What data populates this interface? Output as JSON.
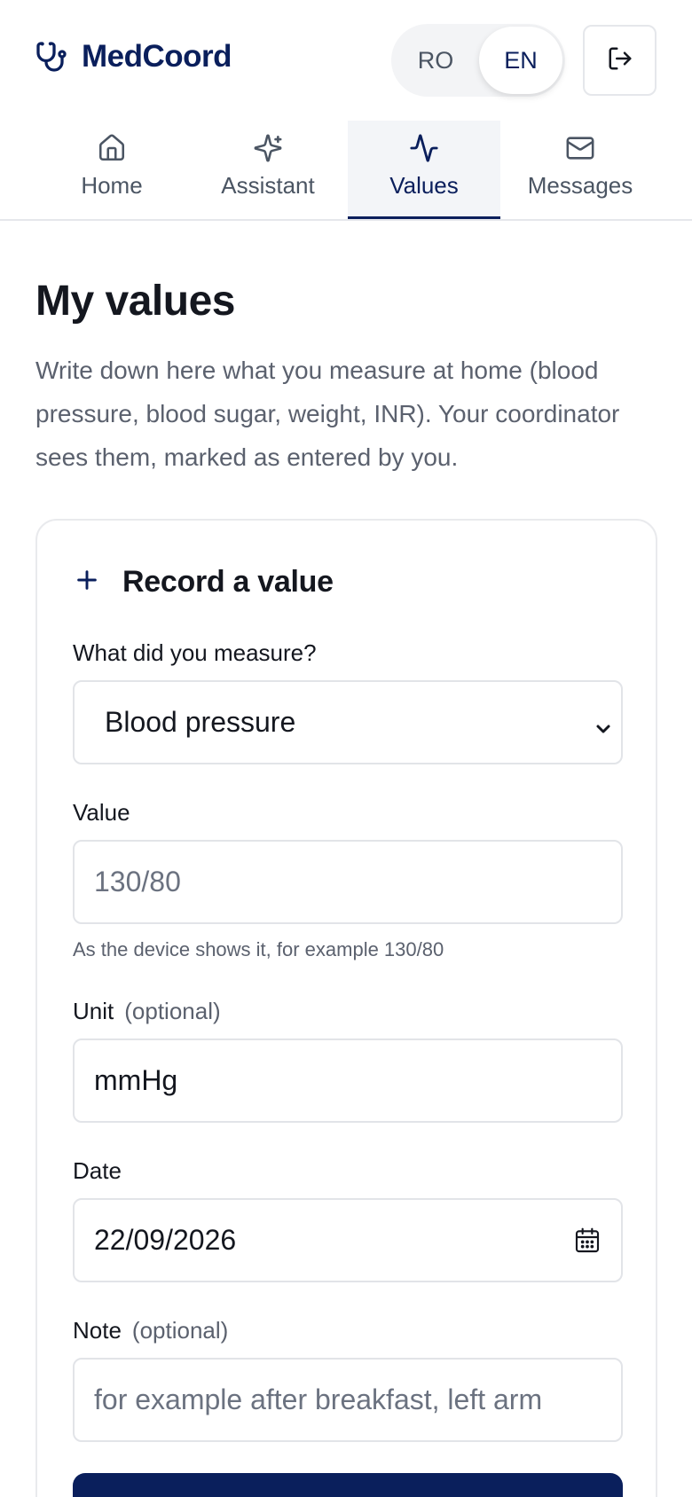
{
  "app": {
    "name": "MedCoord",
    "logo_icon": "stethoscope-icon"
  },
  "language": {
    "options": [
      "RO",
      "EN"
    ],
    "selected": "EN"
  },
  "header": {
    "logout_icon": "logout-icon"
  },
  "tabs": [
    {
      "label": "Home",
      "icon": "home-icon",
      "active": false
    },
    {
      "label": "Assistant",
      "icon": "sparkles-icon",
      "active": false
    },
    {
      "label": "Values",
      "icon": "activity-icon",
      "active": true
    },
    {
      "label": "Messages",
      "icon": "mail-icon",
      "active": false
    }
  ],
  "main": {
    "title": "My values",
    "description": "Write down here what you measure at home (blood pressure, blood sugar, weight, INR). Your coordinator sees them, marked as entered by you."
  },
  "form": {
    "title": "Record a value",
    "title_icon": "plus-icon",
    "measure": {
      "label": "What did you measure?",
      "selected": "Blood pressure"
    },
    "value": {
      "label": "Value",
      "placeholder": "130/80",
      "hint": "As the device shows it, for example 130/80"
    },
    "unit": {
      "label": "Unit",
      "optional": "(optional)",
      "value": "mmHg"
    },
    "date": {
      "label": "Date",
      "value": "22/09/2026",
      "icon": "calendar-icon"
    },
    "note": {
      "label": "Note",
      "optional": "(optional)",
      "placeholder": "for example after breakfast, left arm"
    }
  },
  "colors": {
    "brand": "#0a1f5c",
    "muted_text": "#5b616e",
    "border": "#e2e4e8"
  }
}
